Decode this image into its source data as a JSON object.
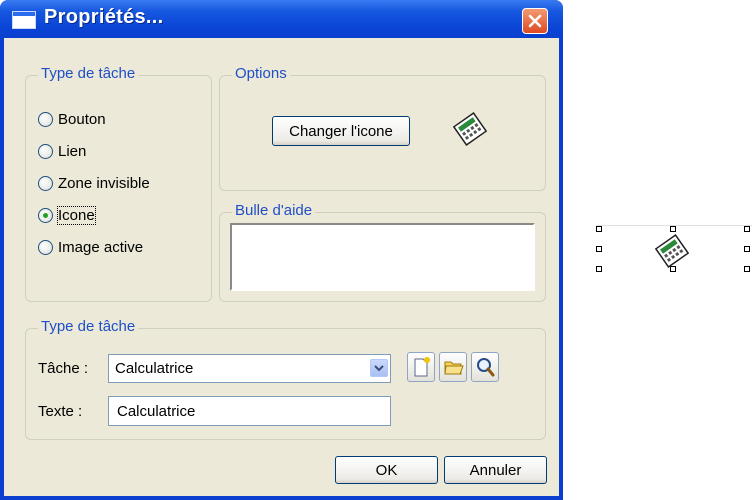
{
  "window": {
    "title": "Propriétés..."
  },
  "task_type_group": {
    "label": "Type de tâche",
    "options": [
      {
        "label": "Bouton",
        "checked": false
      },
      {
        "label": "Lien",
        "checked": false
      },
      {
        "label": "Zone invisible",
        "checked": false
      },
      {
        "label": "Icone",
        "checked": true
      },
      {
        "label": "Image active",
        "checked": false
      }
    ]
  },
  "options_group": {
    "label": "Options",
    "change_icon_button": "Changer l'icone",
    "icon": "calculator-icon"
  },
  "tooltip_group": {
    "label": "Bulle d'aide",
    "value": ""
  },
  "task_group": {
    "label": "Type de tâche",
    "task_label": "Tâche :",
    "task_value": "Calculatrice",
    "text_label": "Texte :",
    "text_value": "Calculatrice",
    "tool_icons": [
      "new-file-icon",
      "open-folder-icon",
      "search-icon"
    ]
  },
  "buttons": {
    "ok": "OK",
    "cancel": "Annuler"
  },
  "colors": {
    "title_bar": "#0a3fcf",
    "group_label": "#1f4fc8",
    "close": "#de4a24",
    "dialog_bg": "#ece9d8"
  },
  "canvas_item": {
    "icon": "calculator-icon",
    "selected": true
  }
}
